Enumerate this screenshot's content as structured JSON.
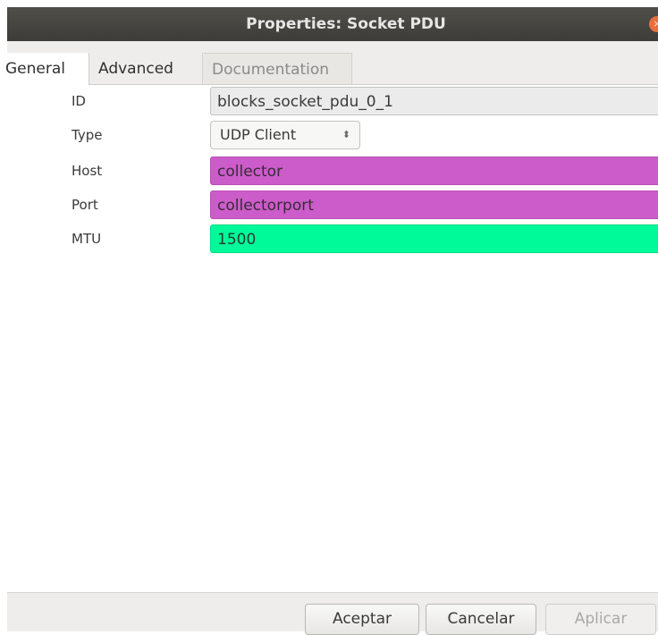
{
  "window": {
    "title": "Properties: Socket PDU",
    "close_glyph": "×"
  },
  "tabs": [
    {
      "label": "General",
      "active": true
    },
    {
      "label": "Advanced",
      "active": false
    },
    {
      "label": "Documentation",
      "active": false
    }
  ],
  "properties": [
    {
      "label": "ID",
      "value": "blocks_socket_pdu_0_1"
    },
    {
      "label": "Type",
      "value": "UDP Client"
    },
    {
      "label": "Host",
      "value": "collector"
    },
    {
      "label": "Port",
      "value": "collectorport"
    },
    {
      "label": "MTU",
      "value": "1500"
    }
  ],
  "type_select": {
    "arrows_glyph": "⬍"
  },
  "buttons": {
    "ok": "Aceptar",
    "cancel": "Cancelar",
    "apply": "Aplicar"
  },
  "colors": {
    "id_field": "#ebebeb",
    "string_param": "#cc5cc9",
    "int_param": "#00fa9a",
    "close_button": "#ea6d3b"
  }
}
